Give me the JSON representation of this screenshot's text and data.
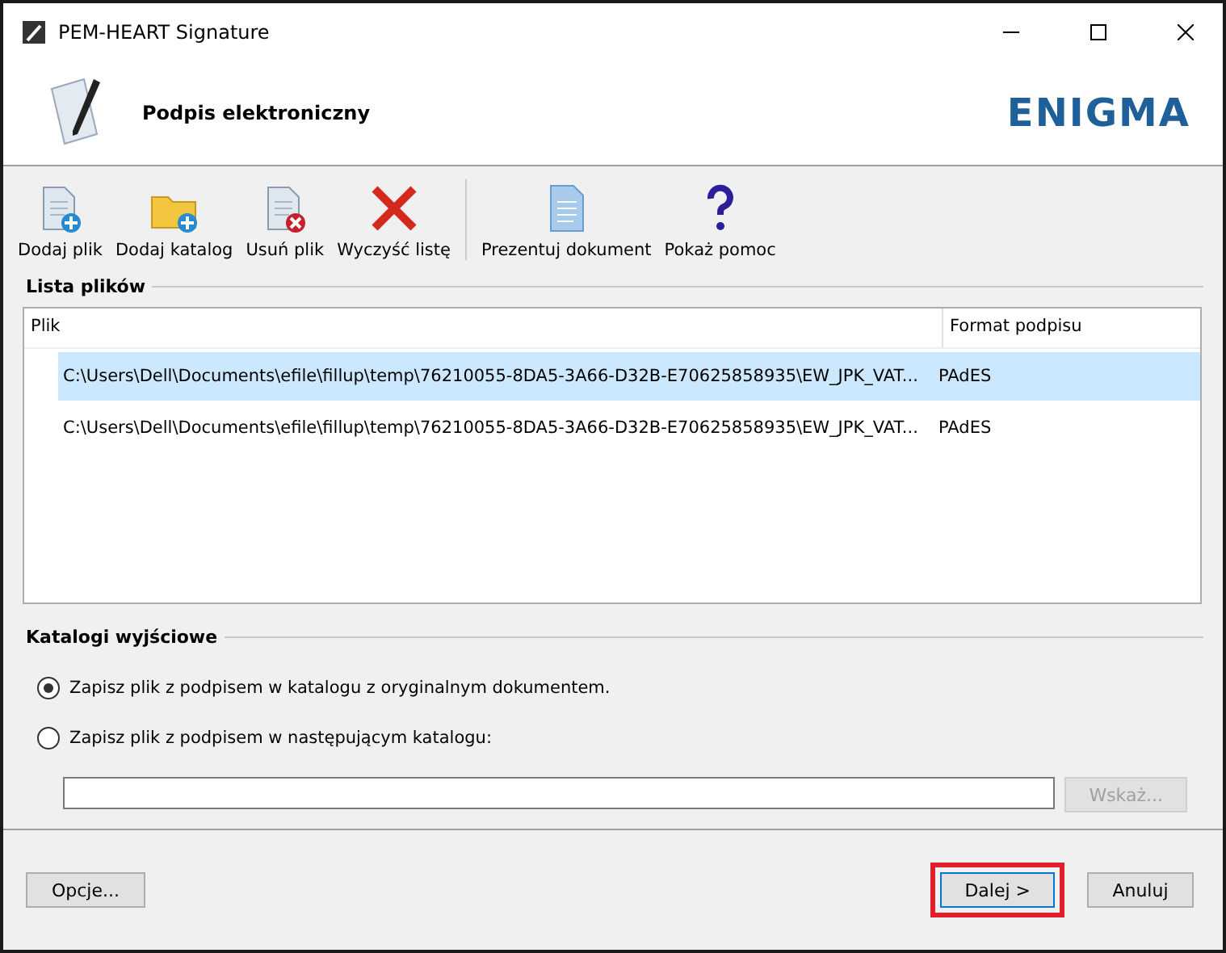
{
  "window": {
    "title": "PEM-HEART Signature"
  },
  "header": {
    "title": "Podpis elektroniczny",
    "logo": "ENIGMA"
  },
  "toolbar": [
    {
      "kind": "add-file",
      "label": "Dodaj plik"
    },
    {
      "kind": "add-folder",
      "label": "Dodaj katalog"
    },
    {
      "kind": "remove-file",
      "label": "Usuń plik"
    },
    {
      "kind": "clear",
      "label": "Wyczyść listę"
    },
    {
      "kind": "separator"
    },
    {
      "kind": "document",
      "label": "Prezentuj dokument"
    },
    {
      "kind": "help",
      "label": "Pokaż pomoc"
    }
  ],
  "file_list": {
    "title": "Lista plików",
    "columns": [
      "Plik",
      "Format podpisu"
    ],
    "rows": [
      {
        "path": "C:\\Users\\Dell\\Documents\\efile\\fillup\\temp\\76210055-8DA5-3A66-D32B-E70625858935\\EW_JPK_VAT...",
        "format": "PAdES",
        "selected": true
      },
      {
        "path": "C:\\Users\\Dell\\Documents\\efile\\fillup\\temp\\76210055-8DA5-3A66-D32B-E70625858935\\EW_JPK_VAT...",
        "format": "PAdES",
        "selected": false
      }
    ]
  },
  "output": {
    "title": "Katalogi wyjściowe",
    "options": [
      {
        "label": "Zapisz plik z podpisem w katalogu z oryginalnym dokumentem.",
        "selected": true
      },
      {
        "label": "Zapisz plik z podpisem w następującym katalogu:",
        "selected": false
      }
    ],
    "browse": {
      "label": "Wskaż...",
      "disabled": true
    }
  },
  "footer": {
    "options_button": "Opcje...",
    "buttons": [
      {
        "label": "Dalej >",
        "highlighted": true
      },
      {
        "label": "Anuluj",
        "highlighted": false
      }
    ]
  }
}
